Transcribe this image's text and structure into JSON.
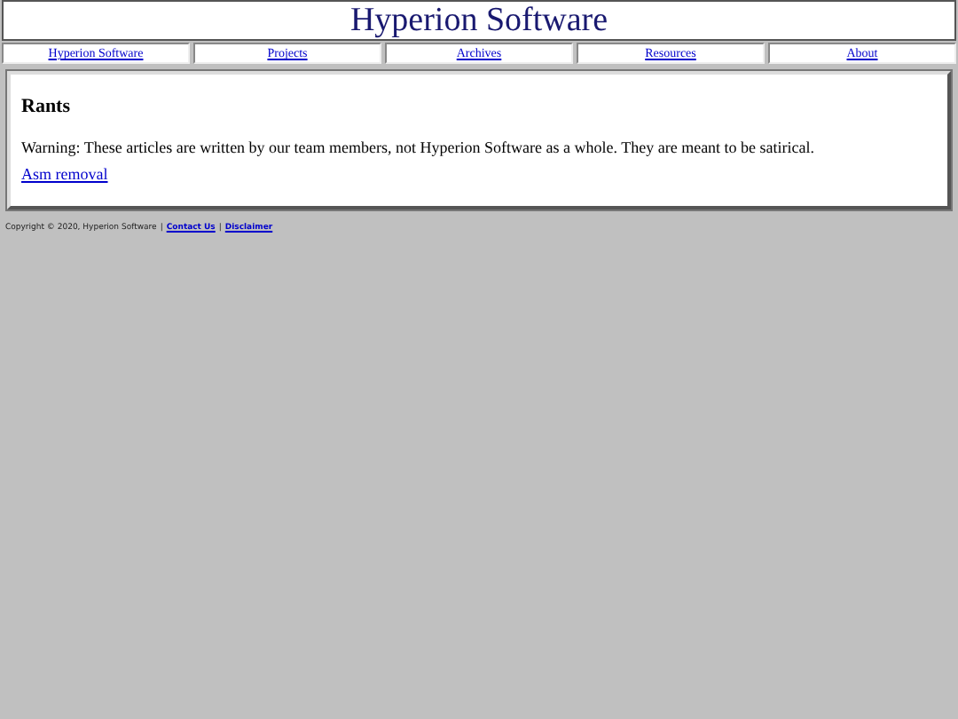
{
  "header": {
    "title": "Hyperion Software"
  },
  "nav": [
    {
      "label": "Hyperion Software"
    },
    {
      "label": "Projects"
    },
    {
      "label": "Archives"
    },
    {
      "label": "Resources"
    },
    {
      "label": "About"
    }
  ],
  "content": {
    "heading": "Rants",
    "text": "Warning: These articles are written by our team members, not Hyperion Software as a whole. They are meant to be satirical.",
    "links": [
      "Asm removal"
    ]
  },
  "footer": [
    {
      "kind": "text",
      "text": "Copyright © 2020, Hyperion Software"
    },
    {
      "kind": "separator",
      "text": "|"
    },
    {
      "kind": "link",
      "text": "Contact Us"
    },
    {
      "kind": "separator",
      "text": "|"
    },
    {
      "kind": "link",
      "text": "Disclaimer"
    }
  ]
}
